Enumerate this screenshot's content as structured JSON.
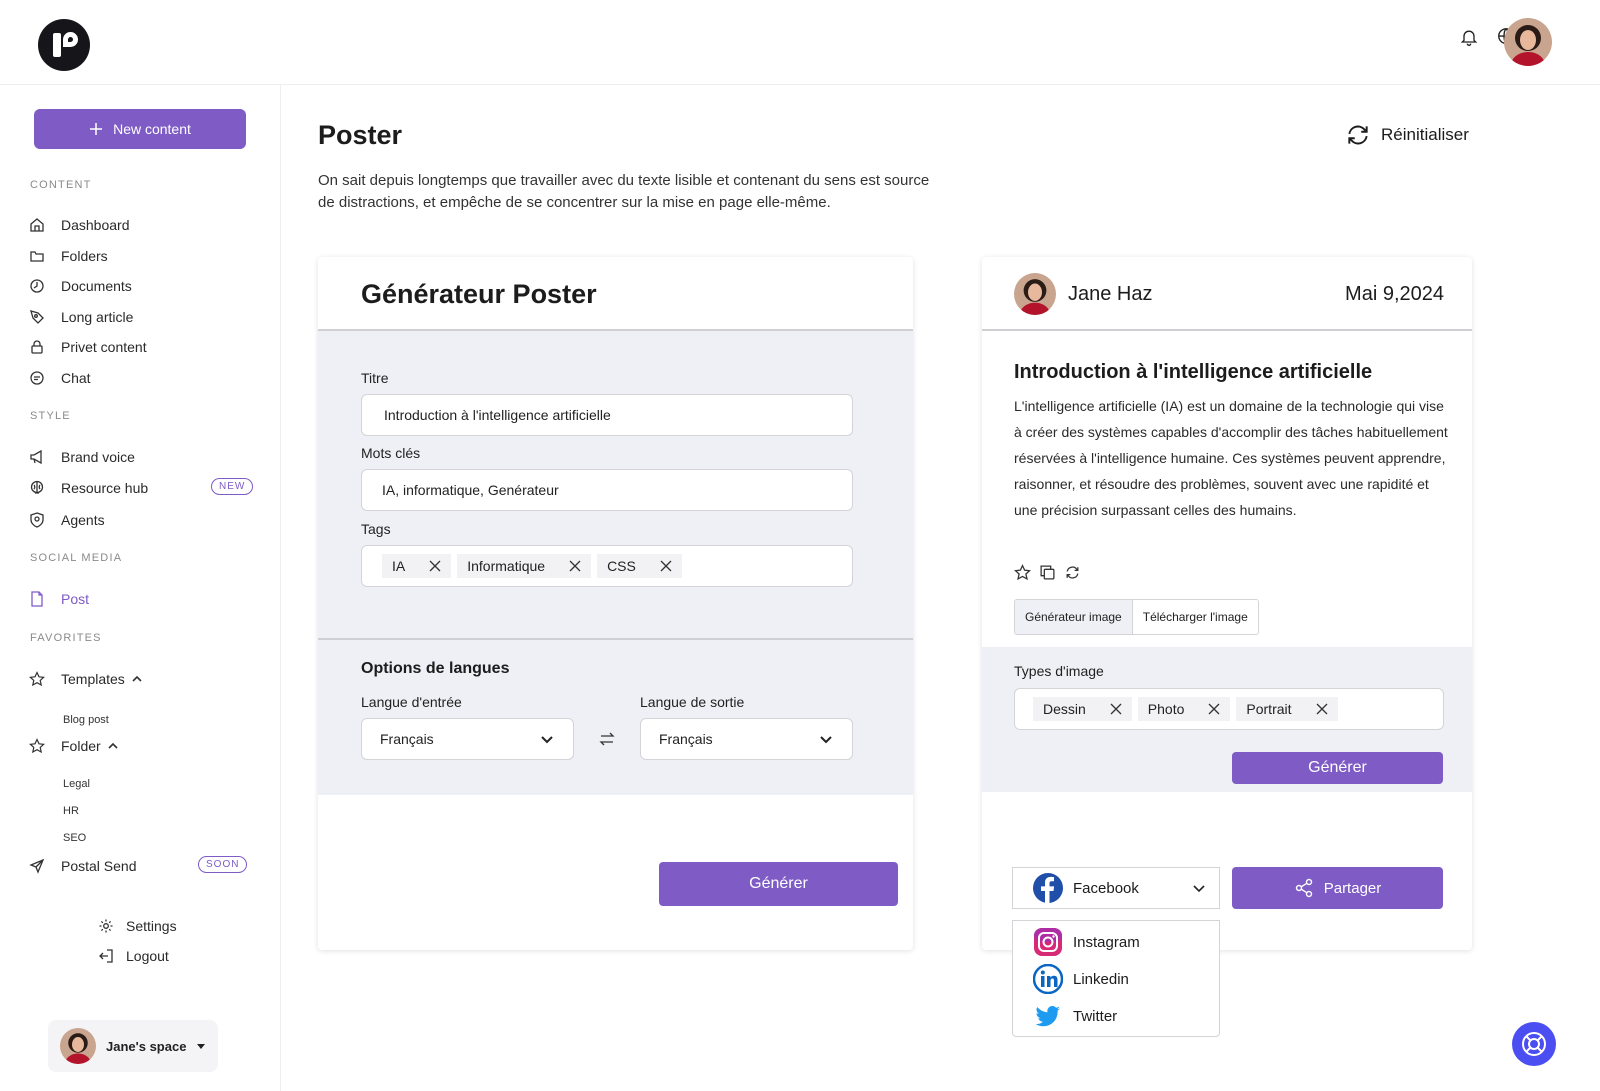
{
  "header": {
    "notifications_icon": "bell-icon",
    "language_icon": "globe-search-icon"
  },
  "sidebar": {
    "new_content": "New content",
    "sections": {
      "content": "CONTENT",
      "style": "STYLE",
      "social": "SOCIAL MEDIA",
      "favorites": "FAVORITES"
    },
    "content_items": [
      "Dashboard",
      "Folders",
      "Documents",
      "Long article",
      "Privet content",
      "Chat"
    ],
    "style_items": [
      "Brand voice",
      "Resource hub",
      "Agents"
    ],
    "social_items": [
      "Post"
    ],
    "favorites": {
      "templates": "Templates",
      "templates_children": [
        "Blog post"
      ],
      "folder": "Folder",
      "folder_children": [
        "Legal",
        "HR",
        "SEO"
      ]
    },
    "postal_send": "Postal Send",
    "badges": {
      "new": "NEW",
      "soon": "SOON"
    },
    "settings": "Settings",
    "logout": "Logout",
    "space": "Jane's space"
  },
  "main": {
    "title": "Poster",
    "description": "On sait depuis longtemps que travailler avec du texte lisible et contenant du sens est source de distractions, et empêche de se concentrer sur la mise en page elle-même.",
    "reset": "Réinitialiser"
  },
  "generator": {
    "title": "Générateur Poster",
    "titre_label": "Titre",
    "titre_value": "Introduction à l'intelligence artificielle",
    "keywords_label": "Mots clés",
    "keywords_value": "IA, informatique, Genérateur",
    "tags_label": "Tags",
    "tags": [
      "IA",
      "Informatique",
      "CSS"
    ],
    "lang_title": "Options de langues",
    "input_lang_label": "Langue d'entrée",
    "input_lang_value": "Français",
    "output_lang_label": "Langue de sortie",
    "output_lang_value": "Français",
    "generate": "Générer"
  },
  "preview": {
    "author": "Jane Haz",
    "date": "Mai 9,2024",
    "article_title": "Introduction à l'intelligence artificielle",
    "article_body": "L'intelligence artificielle (IA) est un domaine de la technologie qui vise à créer des systèmes capables d'accomplir des tâches habituellement réservées à l'intelligence humaine. Ces systèmes peuvent apprendre, raisonner, et résoudre des problèmes, souvent avec une rapidité et une précision surpassant celles des humains.",
    "tab_generate": "Générateur image",
    "tab_download": "Télécharger l'image",
    "image_types_label": "Types d'image",
    "image_types": [
      "Dessin",
      "Photo",
      "Portrait"
    ],
    "generate": "Générer",
    "social_selected": "Facebook",
    "social_options": [
      "Instagram",
      "Linkedin",
      "Twitter"
    ],
    "share": "Partager"
  },
  "colors": {
    "accent": "#7e5bc5",
    "help_button": "#4b4ef0",
    "panel_background": "#eef0f5"
  }
}
